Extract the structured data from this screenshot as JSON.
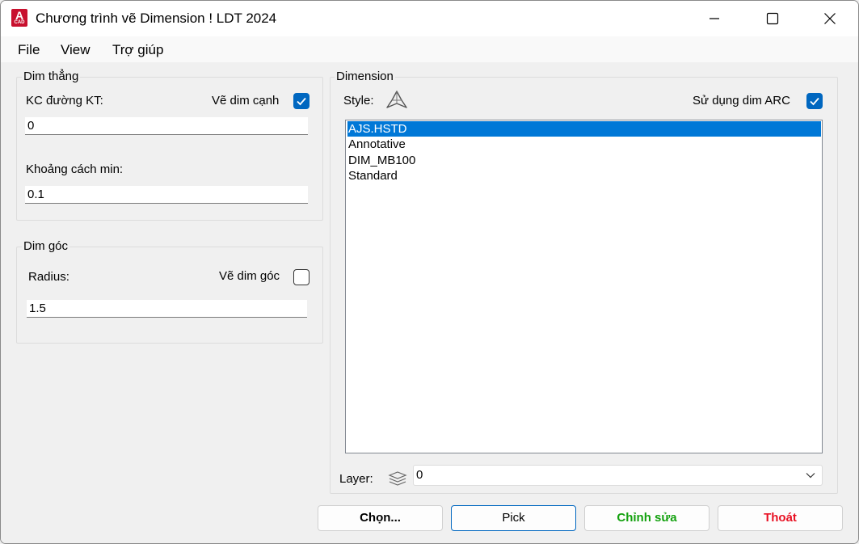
{
  "window": {
    "title": "Chương trình vẽ Dimension ! LDT 2024",
    "app_icon_letter": "A",
    "app_icon_sub": "CAD"
  },
  "menu": [
    "File",
    "View",
    "Trợ giúp"
  ],
  "dim_thang": {
    "title": "Dim thẳng",
    "kc_label": "KC đường KT:",
    "ve_dim_canh_label": "Vẽ dim cạnh",
    "ve_dim_canh_checked": true,
    "kc_value": "0",
    "min_label": "Khoảng cách min:",
    "min_value": "0.1"
  },
  "dim_goc": {
    "title": "Dim góc",
    "radius_label": "Radius:",
    "ve_dim_goc_label": "Vẽ dim góc",
    "ve_dim_goc_checked": false,
    "radius_value": "1.5"
  },
  "dimension": {
    "title": "Dimension",
    "style_label": "Style:",
    "arc_label": "Sử dụng dim ARC",
    "arc_checked": true,
    "styles": [
      "AJS.HSTD",
      "Annotative",
      "DIM_MB100",
      "Standard"
    ],
    "selected_style": "AJS.HSTD",
    "layer_label": "Layer:",
    "layer_value": "0"
  },
  "buttons": {
    "chon": "Chọn...",
    "pick": "Pick",
    "chinh_sua": "Chỉnh sửa",
    "thoat": "Thoát"
  },
  "colors": {
    "accent": "#0067c0",
    "selection": "#0078d7",
    "chinh_sua_text": "#13a10e",
    "thoat_text": "#e81123",
    "app_icon": "#c8102e"
  }
}
